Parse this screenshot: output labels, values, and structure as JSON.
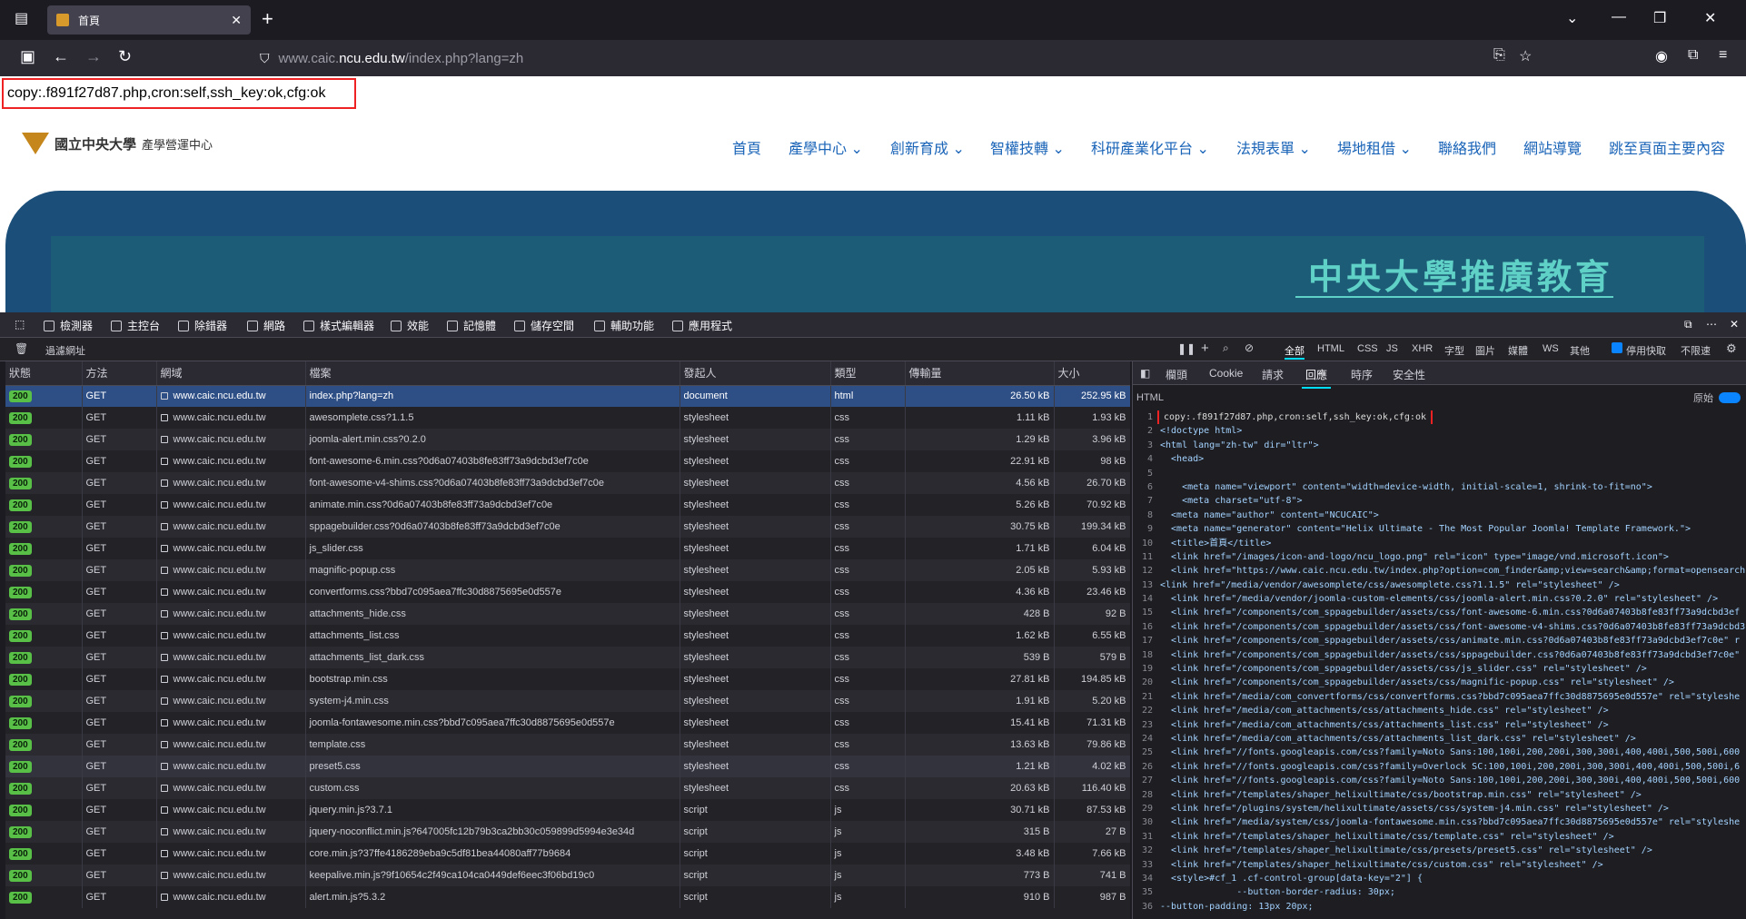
{
  "browser": {
    "tab_title": "首頁",
    "url_prefix": "www.caic.",
    "url_domain": "ncu.edu.tw",
    "url_suffix": "/index.php?lang=zh"
  },
  "page": {
    "debug_text": "copy:.f891f27d87.php,cron:self,ssh_key:ok,cfg:ok",
    "logo_title": "國立中央大學",
    "logo_sub": "產學營運中心",
    "menu": [
      "首頁",
      "產學中心 ⌄",
      "創新育成 ⌄",
      "智權技轉 ⌄",
      "科研產業化平台 ⌄",
      "法規表單 ⌄",
      "場地租借 ⌄",
      "聯絡我們",
      "網站導覽",
      "跳至頁面主要內容"
    ],
    "banner_title": "中央大學推廣教育"
  },
  "devtools": {
    "tabs": [
      "檢測器",
      "主控台",
      "除錯器",
      "網路",
      "樣式編輯器",
      "效能",
      "記憶體",
      "儲存空間",
      "輔助功能",
      "應用程式"
    ],
    "filter_placeholder": "過濾網址",
    "type_filters": [
      "全部",
      "HTML",
      "CSS",
      "JS",
      "XHR",
      "字型",
      "圖片",
      "媒體",
      "WS",
      "其他"
    ],
    "disable_cache": "停用快取",
    "throttle": "不限速",
    "columns": [
      "狀態",
      "方法",
      "網域",
      "檔案",
      "發起人",
      "類型",
      "傳輸量",
      "大小"
    ],
    "requests": [
      [
        "200",
        "GET",
        "www.caic.ncu.edu.tw",
        "index.php?lang=zh",
        "document",
        "html",
        "26.50 kB",
        "252.95 kB"
      ],
      [
        "200",
        "GET",
        "www.caic.ncu.edu.tw",
        "awesomplete.css?1.1.5",
        "stylesheet",
        "css",
        "1.11 kB",
        "1.93 kB"
      ],
      [
        "200",
        "GET",
        "www.caic.ncu.edu.tw",
        "joomla-alert.min.css?0.2.0",
        "stylesheet",
        "css",
        "1.29 kB",
        "3.96 kB"
      ],
      [
        "200",
        "GET",
        "www.caic.ncu.edu.tw",
        "font-awesome-6.min.css?0d6a07403b8fe83ff73a9dcbd3ef7c0e",
        "stylesheet",
        "css",
        "22.91 kB",
        "98 kB"
      ],
      [
        "200",
        "GET",
        "www.caic.ncu.edu.tw",
        "font-awesome-v4-shims.css?0d6a07403b8fe83ff73a9dcbd3ef7c0e",
        "stylesheet",
        "css",
        "4.56 kB",
        "26.70 kB"
      ],
      [
        "200",
        "GET",
        "www.caic.ncu.edu.tw",
        "animate.min.css?0d6a07403b8fe83ff73a9dcbd3ef7c0e",
        "stylesheet",
        "css",
        "5.26 kB",
        "70.92 kB"
      ],
      [
        "200",
        "GET",
        "www.caic.ncu.edu.tw",
        "sppagebuilder.css?0d6a07403b8fe83ff73a9dcbd3ef7c0e",
        "stylesheet",
        "css",
        "30.75 kB",
        "199.34 kB"
      ],
      [
        "200",
        "GET",
        "www.caic.ncu.edu.tw",
        "js_slider.css",
        "stylesheet",
        "css",
        "1.71 kB",
        "6.04 kB"
      ],
      [
        "200",
        "GET",
        "www.caic.ncu.edu.tw",
        "magnific-popup.css",
        "stylesheet",
        "css",
        "2.05 kB",
        "5.93 kB"
      ],
      [
        "200",
        "GET",
        "www.caic.ncu.edu.tw",
        "convertforms.css?bbd7c095aea7ffc30d8875695e0d557e",
        "stylesheet",
        "css",
        "4.36 kB",
        "23.46 kB"
      ],
      [
        "200",
        "GET",
        "www.caic.ncu.edu.tw",
        "attachments_hide.css",
        "stylesheet",
        "css",
        "428 B",
        "92 B"
      ],
      [
        "200",
        "GET",
        "www.caic.ncu.edu.tw",
        "attachments_list.css",
        "stylesheet",
        "css",
        "1.62 kB",
        "6.55 kB"
      ],
      [
        "200",
        "GET",
        "www.caic.ncu.edu.tw",
        "attachments_list_dark.css",
        "stylesheet",
        "css",
        "539 B",
        "579 B"
      ],
      [
        "200",
        "GET",
        "www.caic.ncu.edu.tw",
        "bootstrap.min.css",
        "stylesheet",
        "css",
        "27.81 kB",
        "194.85 kB"
      ],
      [
        "200",
        "GET",
        "www.caic.ncu.edu.tw",
        "system-j4.min.css",
        "stylesheet",
        "css",
        "1.91 kB",
        "5.20 kB"
      ],
      [
        "200",
        "GET",
        "www.caic.ncu.edu.tw",
        "joomla-fontawesome.min.css?bbd7c095aea7ffc30d8875695e0d557e",
        "stylesheet",
        "css",
        "15.41 kB",
        "71.31 kB"
      ],
      [
        "200",
        "GET",
        "www.caic.ncu.edu.tw",
        "template.css",
        "stylesheet",
        "css",
        "13.63 kB",
        "79.86 kB"
      ],
      [
        "200",
        "GET",
        "www.caic.ncu.edu.tw",
        "preset5.css",
        "stylesheet",
        "css",
        "1.21 kB",
        "4.02 kB"
      ],
      [
        "200",
        "GET",
        "www.caic.ncu.edu.tw",
        "custom.css",
        "stylesheet",
        "css",
        "20.63 kB",
        "116.40 kB"
      ],
      [
        "200",
        "GET",
        "www.caic.ncu.edu.tw",
        "jquery.min.js?3.7.1",
        "script",
        "js",
        "30.71 kB",
        "87.53 kB"
      ],
      [
        "200",
        "GET",
        "www.caic.ncu.edu.tw",
        "jquery-noconflict.min.js?647005fc12b79b3ca2bb30c059899d5994e3e34d",
        "script",
        "js",
        "315 B",
        "27 B"
      ],
      [
        "200",
        "GET",
        "www.caic.ncu.edu.tw",
        "core.min.js?37ffe4186289eba9c5df81bea44080aff77b9684",
        "script",
        "js",
        "3.48 kB",
        "7.66 kB"
      ],
      [
        "200",
        "GET",
        "www.caic.ncu.edu.tw",
        "keepalive.min.js?9f10654c2f49ca104ca0449def6eec3f06bd19c0",
        "script",
        "js",
        "773 B",
        "741 B"
      ],
      [
        "200",
        "GET",
        "www.caic.ncu.edu.tw",
        "alert.min.js?5.3.2",
        "script",
        "js",
        "910 B",
        "987 B"
      ]
    ],
    "detail_tabs": [
      "欄頭",
      "Cookie",
      "請求",
      "回應",
      "時序",
      "安全性"
    ],
    "detail_label": "HTML",
    "raw_label": "原始",
    "code_lines": [
      "copy:.f891f27d87.php,cron:self,ssh_key:ok,cfg:ok",
      "<!doctype html>",
      "<html lang=\"zh-tw\" dir=\"ltr\">",
      "  <head>",
      "",
      "    <meta name=\"viewport\" content=\"width=device-width, initial-scale=1, shrink-to-fit=no\">",
      "    <meta charset=\"utf-8\">",
      "  <meta name=\"author\" content=\"NCUCAIC\">",
      "  <meta name=\"generator\" content=\"Helix Ultimate - The Most Popular Joomla! Template Framework.\">",
      "  <title>首頁</title>",
      "  <link href=\"/images/icon-and-logo/ncu_logo.png\" rel=\"icon\" type=\"image/vnd.microsoft.icon\">",
      "  <link href=\"https://www.caic.ncu.edu.tw/index.php?option=com_finder&amp;view=search&amp;format=opensearch",
      "<link href=\"/media/vendor/awesomplete/css/awesomplete.css?1.1.5\" rel=\"stylesheet\" />",
      "  <link href=\"/media/vendor/joomla-custom-elements/css/joomla-alert.min.css?0.2.0\" rel=\"stylesheet\" />",
      "  <link href=\"/components/com_sppagebuilder/assets/css/font-awesome-6.min.css?0d6a07403b8fe83ff73a9dcbd3ef",
      "  <link href=\"/components/com_sppagebuilder/assets/css/font-awesome-v4-shims.css?0d6a07403b8fe83ff73a9dcbd3",
      "  <link href=\"/components/com_sppagebuilder/assets/css/animate.min.css?0d6a07403b8fe83ff73a9dcbd3ef7c0e\" r",
      "  <link href=\"/components/com_sppagebuilder/assets/css/sppagebuilder.css?0d6a07403b8fe83ff73a9dcbd3ef7c0e\"",
      "  <link href=\"/components/com_sppagebuilder/assets/css/js_slider.css\" rel=\"stylesheet\" />",
      "  <link href=\"/components/com_sppagebuilder/assets/css/magnific-popup.css\" rel=\"stylesheet\" />",
      "  <link href=\"/media/com_convertforms/css/convertforms.css?bbd7c095aea7ffc30d8875695e0d557e\" rel=\"styleshe",
      "  <link href=\"/media/com_attachments/css/attachments_hide.css\" rel=\"stylesheet\" />",
      "  <link href=\"/media/com_attachments/css/attachments_list.css\" rel=\"stylesheet\" />",
      "  <link href=\"/media/com_attachments/css/attachments_list_dark.css\" rel=\"stylesheet\" />",
      "  <link href=\"//fonts.googleapis.com/css?family=Noto Sans:100,100i,200,200i,300,300i,400,400i,500,500i,600",
      "  <link href=\"//fonts.googleapis.com/css?family=Overlock SC:100,100i,200,200i,300,300i,400,400i,500,500i,6",
      "  <link href=\"//fonts.googleapis.com/css?family=Noto Sans:100,100i,200,200i,300,300i,400,400i,500,500i,600",
      "  <link href=\"/templates/shaper_helixultimate/css/bootstrap.min.css\" rel=\"stylesheet\" />",
      "  <link href=\"/plugins/system/helixultimate/assets/css/system-j4.min.css\" rel=\"stylesheet\" />",
      "  <link href=\"/media/system/css/joomla-fontawesome.min.css?bbd7c095aea7ffc30d8875695e0d557e\" rel=\"styleshe",
      "  <link href=\"/templates/shaper_helixultimate/css/template.css\" rel=\"stylesheet\" />",
      "  <link href=\"/templates/shaper_helixultimate/css/presets/preset5.css\" rel=\"stylesheet\" />",
      "  <link href=\"/templates/shaper_helixultimate/css/custom.css\" rel=\"stylesheet\" />",
      "  <style>#cf_1 .cf-control-group[data-key=\"2\"] {",
      "              --button-border-radius: 30px;",
      "--button-padding: 13px 20px;"
    ]
  }
}
